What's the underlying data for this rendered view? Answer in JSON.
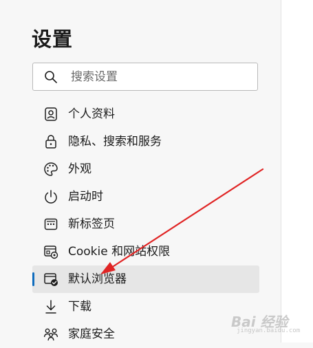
{
  "page": {
    "title": "设置"
  },
  "search": {
    "placeholder": "搜索设置",
    "value": ""
  },
  "nav": {
    "items": [
      {
        "label": "个人资料",
        "icon": "profile-icon",
        "active": false
      },
      {
        "label": "隐私、搜索和服务",
        "icon": "lock-icon",
        "active": false
      },
      {
        "label": "外观",
        "icon": "palette-icon",
        "active": false
      },
      {
        "label": "启动时",
        "icon": "power-icon",
        "active": false
      },
      {
        "label": "新标签页",
        "icon": "new-tab-icon",
        "active": false
      },
      {
        "label": "Cookie 和网站权限",
        "icon": "site-permissions-icon",
        "active": false
      },
      {
        "label": "默认浏览器",
        "icon": "default-browser-icon",
        "active": true
      },
      {
        "label": "下载",
        "icon": "download-icon",
        "active": false
      },
      {
        "label": "家庭安全",
        "icon": "family-icon",
        "active": false
      }
    ]
  },
  "annotation": {
    "arrow_color": "#e02424",
    "points_to": "默认浏览器"
  },
  "colors": {
    "accent": "#0f6cbd",
    "active_bg": "#e6e6e6",
    "sidebar_bg": "#f7f7f7"
  },
  "watermark": {
    "text": "Bai 经验",
    "sub": "jingyan.baidu.com"
  }
}
